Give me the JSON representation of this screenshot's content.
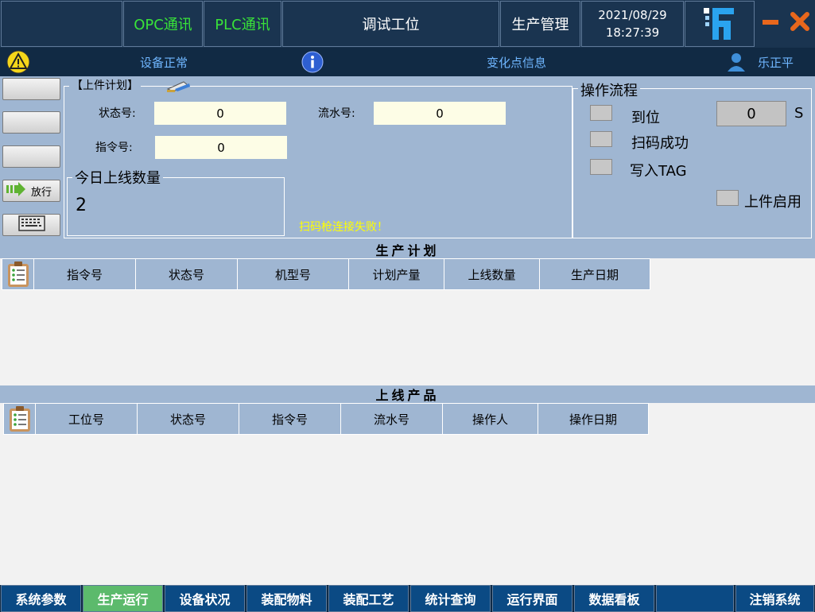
{
  "header": {
    "opc_label": "OPC通讯",
    "plc_label": "PLC通讯",
    "station_title": "调试工位",
    "production_mgmt": "生产管理",
    "date": "2021/08/29",
    "time": "18:27:39",
    "logo_icon": "logo-icon",
    "minimize_icon": "minimize-icon",
    "close_icon": "close-icon"
  },
  "statusbar": {
    "warning_icon": "warning-icon",
    "device_status": "设备正常",
    "info_icon": "info-icon",
    "change_point": "变化点信息",
    "user_icon": "user-icon",
    "user_name": "乐正平"
  },
  "side_buttons": {
    "release_label": "放行",
    "release_icon": "arrow-right-icon",
    "keyboard_icon": "keyboard-icon"
  },
  "loading_plan": {
    "title": "【上件计划】",
    "status_label": "状态号:",
    "status_value": "0",
    "serial_label": "流水号:",
    "serial_value": "0",
    "command_label": "指令号:",
    "command_value": "0",
    "today_title": "今日上线数量",
    "today_value": "2",
    "scanner_error": "扫码枪连接失败！"
  },
  "operation_flow": {
    "title": "操作流程",
    "arrived_label": "到位",
    "scan_ok_label": "扫码成功",
    "write_tag_label": "写入TAG",
    "enable_label": "上件启用",
    "timer_value": "0",
    "timer_unit": "S"
  },
  "production_plan": {
    "title": "生产计划",
    "columns": [
      "指令号",
      "状态号",
      "机型号",
      "计划产量",
      "上线数量",
      "生产日期"
    ],
    "rows": []
  },
  "online_products": {
    "title": "上线产品",
    "columns": [
      "工位号",
      "状态号",
      "指令号",
      "流水号",
      "操作人",
      "操作日期"
    ],
    "rows": []
  },
  "bottom_nav": {
    "items": [
      "系统参数",
      "生产运行",
      "设备状况",
      "装配物料",
      "装配工艺",
      "统计查询",
      "运行界面",
      "数据看板",
      "",
      "注销系统"
    ],
    "active_index": 1
  },
  "colors": {
    "header_bg": "#1a3450",
    "status_bg": "#112a44",
    "panel_bg": "#9fb6d2",
    "nav_bg": "#0b4a84",
    "nav_active": "#5cba6c",
    "comm_ok": "#39e339",
    "warn_text": "#ffff00",
    "status_text": "#6fb6ff"
  }
}
